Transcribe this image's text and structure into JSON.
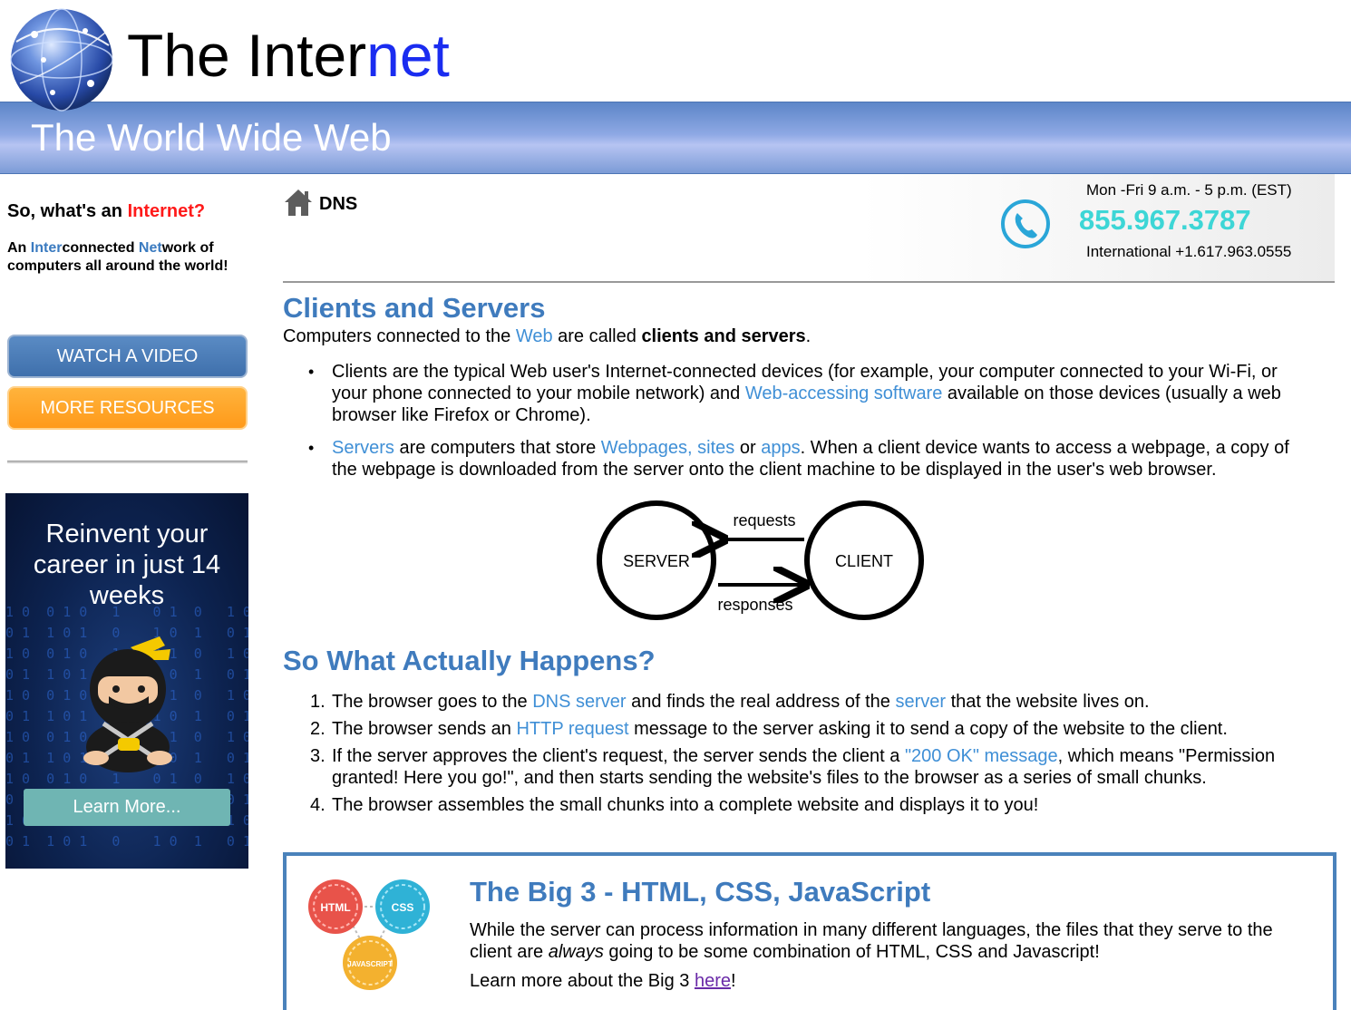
{
  "header": {
    "title_part1": "The Inter",
    "title_part2": "net",
    "subtitle": "The World Wide Web"
  },
  "sidebar": {
    "question_prefix": "So, what's an ",
    "question_highlight": "Internet?",
    "desc_part1": "An ",
    "desc_part2": "Inter",
    "desc_part3": "connected ",
    "desc_part4": "Net",
    "desc_part5": "work of computers all around the world!",
    "watch_video": "WATCH A VIDEO",
    "more_resources": "MORE RESOURCES",
    "ad": {
      "title": "Reinvent your career in just 14 weeks",
      "button": "Learn More..."
    }
  },
  "topbar": {
    "breadcrumb": "DNS",
    "hours": "Mon -Fri 9 a.m. - 5 p.m. (EST)",
    "phone": "855.967.3787",
    "international": "International +1.617.963.0555"
  },
  "section1": {
    "heading": "Clients and Servers",
    "intro_a": "Computers connected to the ",
    "intro_link": "Web",
    "intro_b": " are called ",
    "intro_bold": "clients and servers",
    "intro_c": ".",
    "bullet1_a": "Clients are the typical Web user's Internet-connected devices (for example, your computer connected to your Wi-Fi, or your phone connected to your mobile network) and ",
    "bullet1_link": "Web-accessing software",
    "bullet1_b": " available on those devices (usually a web browser like Firefox or Chrome).",
    "bullet2_link1": "Servers",
    "bullet2_a": " are computers that store ",
    "bullet2_link2": "Webpages, sites",
    "bullet2_b": " or ",
    "bullet2_link3": "apps",
    "bullet2_c": ". When a client device wants to access a webpage, a copy of the webpage is downloaded from the server onto the client machine to be displayed in the user's web browser."
  },
  "diagram": {
    "server": "SERVER",
    "client": "CLIENT",
    "requests": "requests",
    "responses": "responses"
  },
  "section2": {
    "heading": "So What Actually Happens?",
    "steps": [
      {
        "num": "1.",
        "a": "The browser goes to the ",
        "link1": "DNS server",
        "b": " and finds the real address of the ",
        "link2": "server",
        "c": " that the website lives on."
      },
      {
        "num": "2.",
        "a": "The browser sends an ",
        "link1": "HTTP request",
        "b": " message to the server asking it to send a copy of the website to the client."
      },
      {
        "num": "3.",
        "a": "If the server approves the client's request, the server sends the client a ",
        "link1": "\"200 OK\" message",
        "b": ", which means \"Permission granted! Here you go!\", and then starts sending the website's files to the browser as a series of small chunks."
      },
      {
        "num": "4.",
        "a": "The browser assembles the small chunks into a complete website and displays it to you!"
      }
    ]
  },
  "big3": {
    "title": "The Big 3 - HTML, CSS, JavaScript",
    "text_a": "While the server can process information in many different languages, the files that they serve to the client are ",
    "text_em": "always",
    "text_b": " going to be some combination of HTML, CSS and Javascript!",
    "more_a": "Learn more about the Big 3 ",
    "more_link": "here",
    "more_b": "!",
    "logo_html": "HTML",
    "logo_css": "CSS",
    "logo_js": "JAVASCRIPT"
  },
  "colors": {
    "accent_blue": "#3f7bbd",
    "link_blue": "#3f8fd6",
    "phone_teal": "#3dd6d6",
    "resources_orange": "#ff9a1a",
    "highlight_red": "#ff1a1a"
  }
}
